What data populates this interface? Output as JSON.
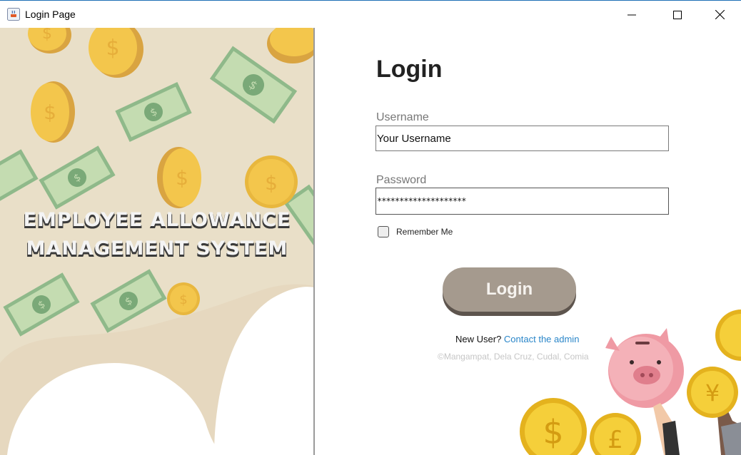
{
  "window": {
    "title": "Login Page"
  },
  "left_panel": {
    "system_title_line1": "EMPLOYEE ALLOWANCE",
    "system_title_line2": "MANAGEMENT SYSTEM",
    "colors": {
      "background": "#e9dfc8",
      "wave": "#ffffff",
      "coin": "#f3c64c",
      "bill": "#b7d5a3"
    }
  },
  "form": {
    "heading": "Login",
    "username_label": "Username",
    "username_value": "Your Username",
    "password_label": "Password",
    "password_value": "********************",
    "remember_label": "Remember Me",
    "remember_checked": false,
    "login_button": "Login",
    "new_user_text": "New User?",
    "contact_link": "Contact the admin",
    "copyright": "©Mangampat, Dela Cruz, Cudal, Comia"
  },
  "colors": {
    "button": "#a59a8e",
    "button_shadow": "#5d544d",
    "link": "#2a86c9",
    "heading": "#222222"
  }
}
